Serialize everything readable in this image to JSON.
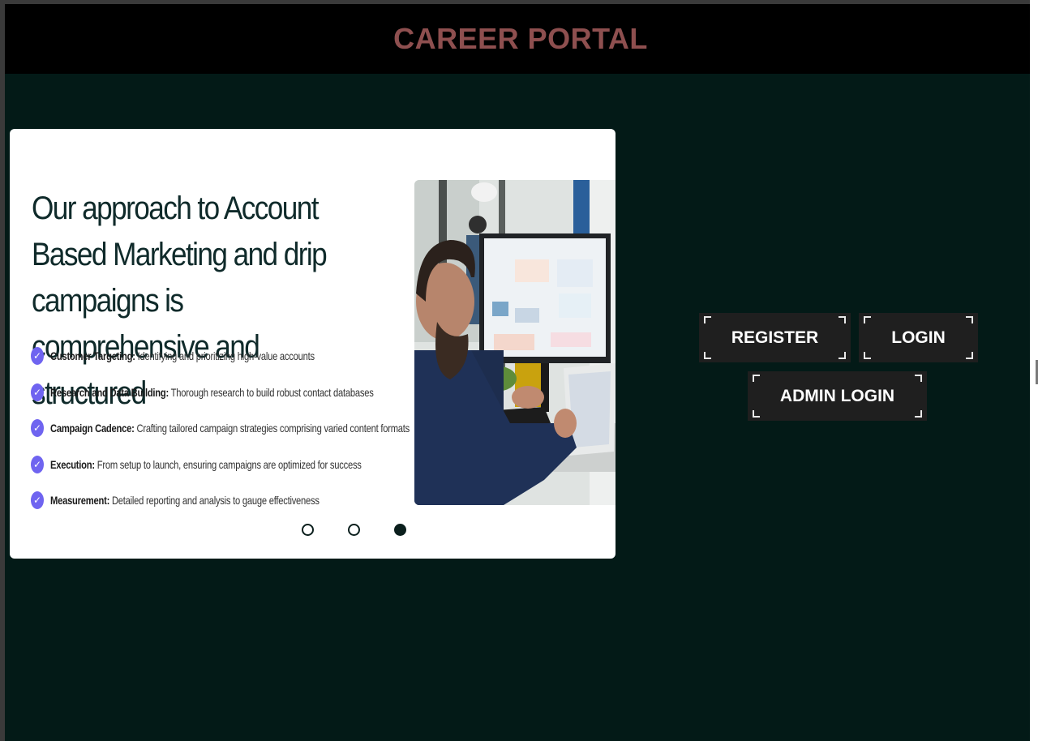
{
  "header": {
    "title": "CAREER PORTAL"
  },
  "slide": {
    "heading": "Our approach to Account Based Marketing and drip campaigns is comprehensive and structured",
    "features": [
      {
        "title": "Customer Targeting:",
        "text": "Identifying and prioritizing high-value accounts"
      },
      {
        "title": "Research and Data Building:",
        "text": "Thorough research to build robust contact databases"
      },
      {
        "title": "Campaign Cadence:",
        "text": "Crafting tailored campaign strategies comprising varied content formats"
      },
      {
        "title": "Execution:",
        "text": "From setup to launch, ensuring campaigns are optimized for success"
      },
      {
        "title": "Measurement:",
        "text": "Detailed reporting and analysis to gauge effectiveness"
      }
    ],
    "active_dot": 3,
    "dot_count": 3
  },
  "actions": {
    "register_label": "REGISTER",
    "login_label": "LOGIN",
    "admin_login_label": "ADMIN LOGIN"
  },
  "colors": {
    "background": "#031a17",
    "header": "#000000",
    "title": "#8e4f4f",
    "button": "#1f1f1f",
    "check": "#6f64f0"
  },
  "icons": [
    "check-icon",
    "carousel-dot-icon"
  ]
}
